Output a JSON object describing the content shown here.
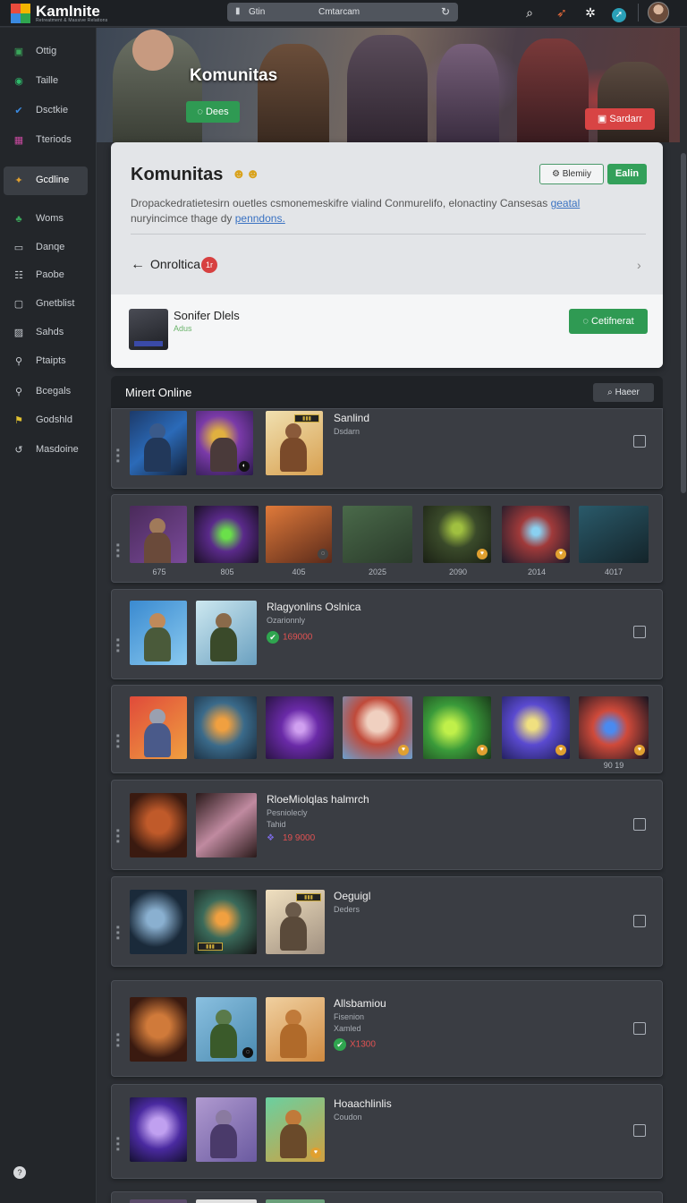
{
  "app": {
    "title": "Kamlnite",
    "subtitle": "Retreatment & Massive Relations"
  },
  "topbar": {
    "search_tab": "Gtin",
    "search_center": "Cmtarcam"
  },
  "sidebar": {
    "items": [
      {
        "label": "Ottig",
        "icon": "grid-icon",
        "color": "#3aa55a"
      },
      {
        "label": "Taille",
        "icon": "circle-icon",
        "color": "#2fb86a"
      },
      {
        "label": "Dsctkie",
        "icon": "check-icon",
        "color": "#3a8ae0"
      },
      {
        "label": "Tteriods",
        "icon": "image-icon",
        "color": "#c94aa0"
      },
      {
        "label": "Gcdline",
        "icon": "puzzle-icon",
        "color": "#e0a030"
      },
      {
        "label": "Woms",
        "icon": "leaf-icon",
        "color": "#3aa55a"
      },
      {
        "label": "Danqe",
        "icon": "monitor-icon",
        "color": "#c9cdd2"
      },
      {
        "label": "Paobe",
        "icon": "list-icon",
        "color": "#c9cdd2"
      },
      {
        "label": "Gnetblist",
        "icon": "square-icon",
        "color": "#c9cdd2"
      },
      {
        "label": "Sahds",
        "icon": "photo-icon",
        "color": "#c9cdd2"
      },
      {
        "label": "Ptaipts",
        "icon": "search-icon",
        "color": "#c9cdd2"
      },
      {
        "label": "Bcegals",
        "icon": "search-icon",
        "color": "#c9cdd2"
      },
      {
        "label": "Godshld",
        "icon": "flag-icon",
        "color": "#e0c030"
      },
      {
        "label": "Masdoine",
        "icon": "refresh-icon",
        "color": "#c9cdd2"
      }
    ]
  },
  "banner": {
    "title": "Komunitas",
    "green_button": "Dees",
    "red_button": "Sardarr"
  },
  "community": {
    "title": "Komunitas",
    "outline_button": "Blemiiy",
    "solid_button": "Ealin",
    "description": "Dropackedratietesirn ouetles csmonemeskifre vialind Conmurelifo, elonactiny Cansesas",
    "description_link1": "geatal",
    "description_line2": "nuryincimce thage dy",
    "description_link2": "penndons.",
    "back_label": "Onroltica",
    "back_badge": "1r",
    "item_name": "Sonifer Dlels",
    "item_sub": "Adus",
    "confirm_button": "Cetifnerat"
  },
  "online": {
    "header": "Mirert Online",
    "header_button": "Haeer",
    "rows": [
      {
        "title": "Sanlind",
        "sub": "Dsdarn"
      },
      {
        "labels": [
          "675",
          "805",
          "405",
          "2025",
          "2090",
          "2014",
          "4017"
        ]
      },
      {
        "title": "Rlagyonlins Oslnica",
        "sub": "Ozarionnly",
        "price": "169000"
      },
      {
        "labels": [
          "90 19"
        ]
      },
      {
        "title": "RloeMiolqlas halmrch",
        "sub": "Pesniolecly",
        "sub2": "Tahid",
        "price": "19 9000"
      },
      {
        "title": "Oeguigl",
        "sub": "Deders"
      },
      {
        "title": "Allsbamiou",
        "sub": "Fisenion",
        "sub2": "Xamled",
        "price": "X1300"
      },
      {
        "title": "Hoaachlinlis",
        "sub": "Coudon"
      }
    ]
  },
  "colors": {
    "accent_green": "#2f9a53",
    "accent_red": "#d84444",
    "panel": "#3a3d43",
    "page_bg": "#2b2e33"
  }
}
